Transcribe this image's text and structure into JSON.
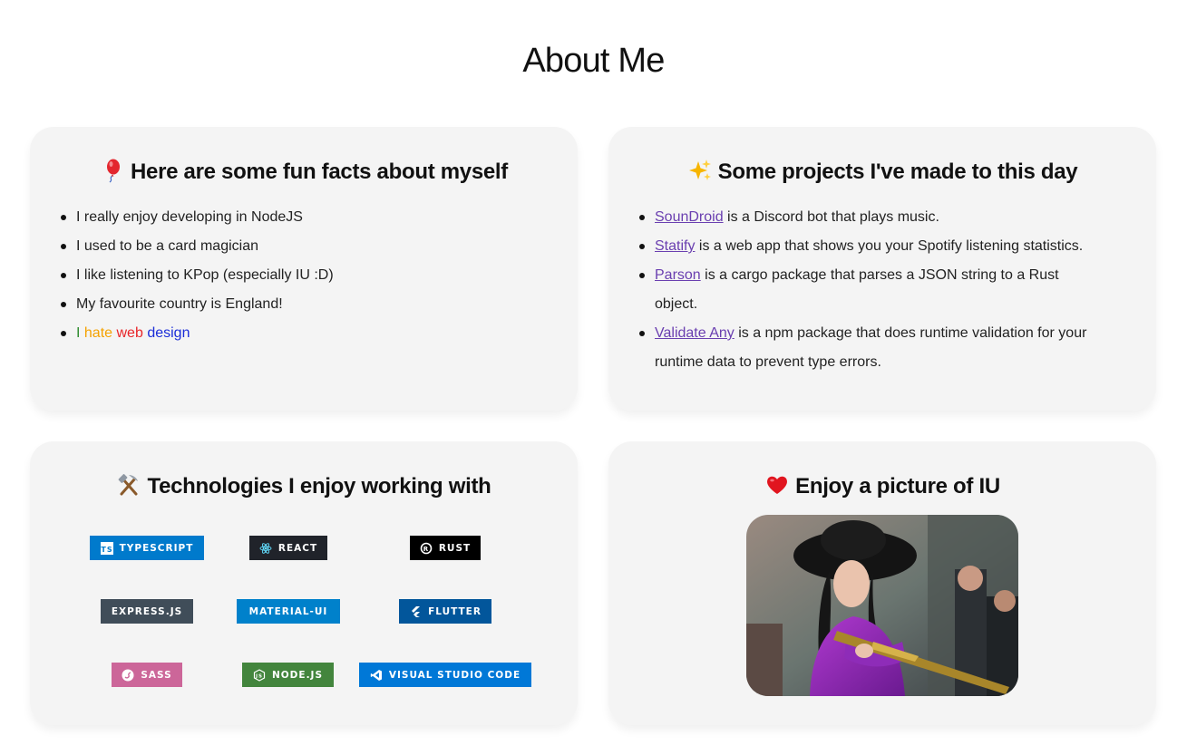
{
  "page": {
    "title": "About Me"
  },
  "fun_facts": {
    "heading": "Here are some fun facts about myself",
    "icon": "balloon-icon",
    "items": [
      "I really enjoy developing in NodeJS",
      "I used to be a card magician",
      "I like listening to KPop (especially IU :D)",
      "My favourite country is England!"
    ],
    "rainbow_item": {
      "w1": "I",
      "w2": "hate",
      "w3": "web",
      "w4": "design"
    }
  },
  "projects": {
    "heading": "Some projects I've made to this day",
    "icon": "sparkles-icon",
    "items": [
      {
        "name": "SounDroid",
        "desc": " is a Discord bot that plays music."
      },
      {
        "name": "Statify",
        "desc": " is a web app that shows you your Spotify listening statistics."
      },
      {
        "name": "Parson",
        "desc": " is a cargo package that parses a JSON string to a Rust object."
      },
      {
        "name": "Validate Any",
        "desc": " is a npm package that does runtime validation for your runtime data to prevent type errors."
      }
    ]
  },
  "technologies": {
    "heading": "Technologies I enjoy working with",
    "icon": "hammer-and-pick-icon",
    "badges": [
      {
        "label": "TYPESCRIPT",
        "color": "#007acc",
        "icon": "typescript-icon"
      },
      {
        "label": "REACT",
        "color": "#20232a",
        "icon": "react-icon"
      },
      {
        "label": "RUST",
        "color": "#000000",
        "icon": "rust-icon"
      },
      {
        "label": "EXPRESS.JS",
        "color": "#404d59",
        "icon": ""
      },
      {
        "label": "MATERIAL-UI",
        "color": "#0081cb",
        "icon": ""
      },
      {
        "label": "FLUTTER",
        "color": "#02569b",
        "icon": "flutter-icon"
      },
      {
        "label": "SASS",
        "color": "#cc6699",
        "icon": "sass-icon"
      },
      {
        "label": "NODE.JS",
        "color": "#43853d",
        "icon": "nodejs-icon"
      },
      {
        "label": "VISUAL STUDIO CODE",
        "color": "#0078d7",
        "icon": "vscode-icon"
      }
    ]
  },
  "picture": {
    "heading": "Enjoy a picture of IU",
    "icon": "red-heart-icon"
  },
  "colors": {
    "link": "#6a3fb0",
    "card_bg": "#f4f4f4"
  }
}
